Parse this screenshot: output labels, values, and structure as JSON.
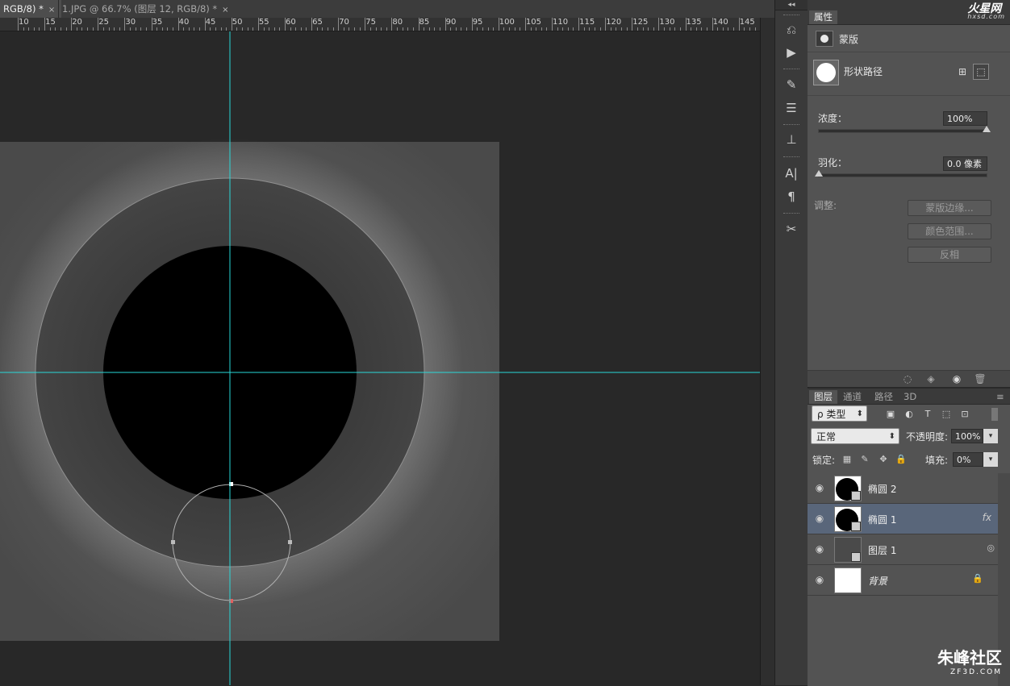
{
  "tabs": [
    {
      "label": "RGB/8) *",
      "close": "×"
    },
    {
      "label": "1.JPG @ 66.7% (图层 12, RGB/8) *",
      "close": "×"
    }
  ],
  "ruler": [
    "10",
    "15",
    "20",
    "25",
    "30",
    "35",
    "40",
    "45",
    "50",
    "55",
    "60",
    "65",
    "70",
    "75",
    "80",
    "85",
    "90",
    "95",
    "100",
    "105",
    "110",
    "115",
    "120",
    "125",
    "130",
    "135",
    "140",
    "145"
  ],
  "toolstrip": {
    "collapse": "◂◂",
    "tools": [
      "history-icon",
      "play-icon",
      "brush-icon",
      "brush-settings-icon",
      "clone-stamp-icon",
      "character-icon",
      "paragraph-icon",
      "tool-presets-icon"
    ]
  },
  "properties": {
    "tab": "属性",
    "logo": "火星网",
    "logo_sub": "hxsd.com",
    "mask_label": "蒙版",
    "shape_label": "形状路径",
    "density_label": "浓度：",
    "density_value": "100%",
    "density_level": 1.0,
    "feather_label": "羽化：",
    "feather_value": "0.0 像素",
    "feather_level": 0.0,
    "adjust_label": "调整:",
    "buttons": [
      "蒙版边缘...",
      "颜色范围...",
      "反相"
    ]
  },
  "layers": {
    "tabs": [
      "图层",
      "通道",
      "路径",
      "3D"
    ],
    "filter_label": "ρ 类型",
    "blend_mode": "正常",
    "opacity_label": "不透明度:",
    "opacity_value": "100%",
    "lock_label": "锁定:",
    "fill_label": "填充:",
    "fill_value": "0%",
    "items": [
      {
        "name": "椭圆 2",
        "fx": ""
      },
      {
        "name": "椭圆 1",
        "fx": "fx"
      },
      {
        "name": "图层 1",
        "fx": ""
      },
      {
        "name": "背景",
        "fx": ""
      }
    ]
  },
  "watermark": {
    "main": "朱峰社区",
    "sub": "ZF3D.COM"
  },
  "colors": {
    "guide": "#29d8d8",
    "selected_layer": "#59667a",
    "panel": "#535353"
  }
}
